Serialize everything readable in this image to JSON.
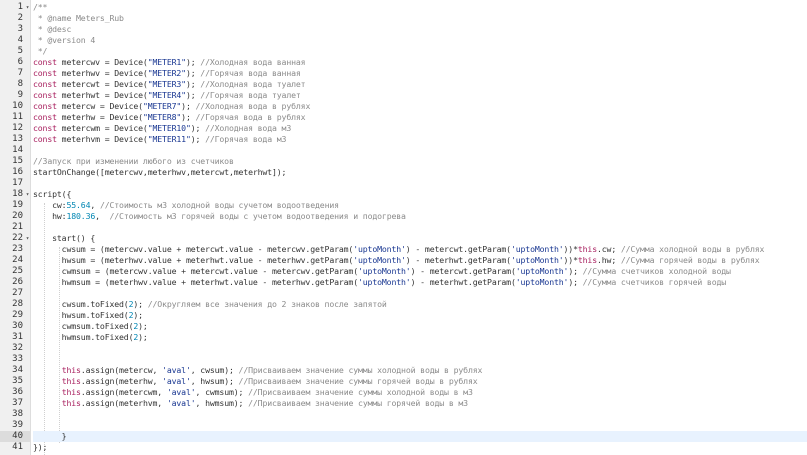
{
  "editor": {
    "lines": [
      [
        [
          "cm",
          "/**"
        ]
      ],
      [
        [
          "cm",
          " * @name Meters_Rub"
        ]
      ],
      [
        [
          "cm",
          " * @desc"
        ]
      ],
      [
        [
          "cm",
          " * @version 4"
        ]
      ],
      [
        [
          "cm",
          " */"
        ]
      ],
      [
        [
          "kw",
          "const"
        ],
        [
          "t",
          " metercwv = Device("
        ],
        [
          "str",
          "\"METER1\""
        ],
        [
          "t",
          "); "
        ],
        [
          "cm",
          "//Холодная вода ванная"
        ]
      ],
      [
        [
          "kw",
          "const"
        ],
        [
          "t",
          " meterhwv = Device("
        ],
        [
          "str",
          "\"METER2\""
        ],
        [
          "t",
          "); "
        ],
        [
          "cm",
          "//Горячая вода ванная"
        ]
      ],
      [
        [
          "kw",
          "const"
        ],
        [
          "t",
          " metercwt = Device("
        ],
        [
          "str",
          "\"METER3\""
        ],
        [
          "t",
          "); "
        ],
        [
          "cm",
          "//Холодная вода туалет"
        ]
      ],
      [
        [
          "kw",
          "const"
        ],
        [
          "t",
          " meterhwt = Device("
        ],
        [
          "str",
          "\"METER4\""
        ],
        [
          "t",
          "); "
        ],
        [
          "cm",
          "//Горячая вода туалет"
        ]
      ],
      [
        [
          "kw",
          "const"
        ],
        [
          "t",
          " metercw = Device("
        ],
        [
          "str",
          "\"METER7\""
        ],
        [
          "t",
          "); "
        ],
        [
          "cm",
          "//Холодная вода в рублях"
        ]
      ],
      [
        [
          "kw",
          "const"
        ],
        [
          "t",
          " meterhw = Device("
        ],
        [
          "str",
          "\"METER8\""
        ],
        [
          "t",
          "); "
        ],
        [
          "cm",
          "//Горячая вода в рублях"
        ]
      ],
      [
        [
          "kw",
          "const"
        ],
        [
          "t",
          " metercwm = Device("
        ],
        [
          "str",
          "\"METER10\""
        ],
        [
          "t",
          "); "
        ],
        [
          "cm",
          "//Холодная вода м3"
        ]
      ],
      [
        [
          "kw",
          "const"
        ],
        [
          "t",
          " meterhvm = Device("
        ],
        [
          "str",
          "\"METER11\""
        ],
        [
          "t",
          "); "
        ],
        [
          "cm",
          "//Горячая вода м3"
        ]
      ],
      [],
      [
        [
          "cm",
          "//Запуск при изменении любого из счетчиков"
        ]
      ],
      [
        [
          "t",
          "startOnChange([metercwv,meterhwv,metercwt,meterhwt]);"
        ]
      ],
      [],
      [
        [
          "t",
          "script({"
        ]
      ],
      [
        [
          "t",
          "    cw:"
        ],
        [
          "num",
          "55.64"
        ],
        [
          "t",
          ", "
        ],
        [
          "cm",
          "//Стоимость м3 холодной воды сучетом водоотведения"
        ]
      ],
      [
        [
          "t",
          "    hw:"
        ],
        [
          "num",
          "180.36"
        ],
        [
          "t",
          ",  "
        ],
        [
          "cm",
          "//Стоимость м3 горячей воды с учетом водоотведения и подогрева"
        ]
      ],
      [],
      [
        [
          "t",
          "    start() {"
        ]
      ],
      [
        [
          "t",
          "      cwsum = (metercwv.value + metercwt.value - metercwv.getParam("
        ],
        [
          "str",
          "'uptoMonth'"
        ],
        [
          "t",
          ") - metercwt.getParam("
        ],
        [
          "str",
          "'uptoMonth'"
        ],
        [
          "t",
          "))*"
        ],
        [
          "kw",
          "this"
        ],
        [
          "t",
          ".cw; "
        ],
        [
          "cm",
          "//Сумма холодной воды в рублях"
        ]
      ],
      [
        [
          "t",
          "      hwsum = (meterhwv.value + meterhwt.value - meterhwv.getParam("
        ],
        [
          "str",
          "'uptoMonth'"
        ],
        [
          "t",
          ") - meterhwt.getParam("
        ],
        [
          "str",
          "'uptoMonth'"
        ],
        [
          "t",
          "))*"
        ],
        [
          "kw",
          "this"
        ],
        [
          "t",
          ".hw; "
        ],
        [
          "cm",
          "//Сумма горячей воды в рублях"
        ]
      ],
      [
        [
          "t",
          "      cwmsum = (metercwv.value + metercwt.value - metercwv.getParam("
        ],
        [
          "str",
          "'uptoMonth'"
        ],
        [
          "t",
          ") - metercwt.getParam("
        ],
        [
          "str",
          "'uptoMonth'"
        ],
        [
          "t",
          "); "
        ],
        [
          "cm",
          "//Сумма счетчиков холодной воды"
        ]
      ],
      [
        [
          "t",
          "      hwmsum = (meterhwv.value + meterhwt.value - meterhwv.getParam("
        ],
        [
          "str",
          "'uptoMonth'"
        ],
        [
          "t",
          ") - meterhwt.getParam("
        ],
        [
          "str",
          "'uptoMonth'"
        ],
        [
          "t",
          "); "
        ],
        [
          "cm",
          "//Сумма счетчиков горячей воды"
        ]
      ],
      [],
      [
        [
          "t",
          "      cwsum.toFixed("
        ],
        [
          "num",
          "2"
        ],
        [
          "t",
          "); "
        ],
        [
          "cm",
          "//Округляем все значения до 2 знаков после запятой"
        ]
      ],
      [
        [
          "t",
          "      hwsum.toFixed("
        ],
        [
          "num",
          "2"
        ],
        [
          "t",
          ");"
        ]
      ],
      [
        [
          "t",
          "      cwmsum.toFixed("
        ],
        [
          "num",
          "2"
        ],
        [
          "t",
          ");"
        ]
      ],
      [
        [
          "t",
          "      hwmsum.toFixed("
        ],
        [
          "num",
          "2"
        ],
        [
          "t",
          ");"
        ]
      ],
      [],
      [],
      [
        [
          "t",
          "      "
        ],
        [
          "kw",
          "this"
        ],
        [
          "t",
          ".assign(metercw, "
        ],
        [
          "str",
          "'aval'"
        ],
        [
          "t",
          ", cwsum); "
        ],
        [
          "cm",
          "//Присваиваем значение суммы холодной воды в рублях"
        ]
      ],
      [
        [
          "t",
          "      "
        ],
        [
          "kw",
          "this"
        ],
        [
          "t",
          ".assign(meterhw, "
        ],
        [
          "str",
          "'aval'"
        ],
        [
          "t",
          ", hwsum); "
        ],
        [
          "cm",
          "//Присваиваем значение суммы горячей воды в рублях"
        ]
      ],
      [
        [
          "t",
          "      "
        ],
        [
          "kw",
          "this"
        ],
        [
          "t",
          ".assign(metercwm, "
        ],
        [
          "str",
          "'aval'"
        ],
        [
          "t",
          ", cwmsum); "
        ],
        [
          "cm",
          "//Присваиваем значение суммы холодной воды в м3"
        ]
      ],
      [
        [
          "t",
          "      "
        ],
        [
          "kw",
          "this"
        ],
        [
          "t",
          ".assign(meterhvm, "
        ],
        [
          "str",
          "'aval'"
        ],
        [
          "t",
          ", hwmsum); "
        ],
        [
          "cm",
          "//Присваиваем значение суммы горячей воды в м3"
        ]
      ],
      [],
      [],
      [
        [
          "t",
          "      }"
        ]
      ],
      [
        [
          "t",
          "});"
        ]
      ]
    ],
    "fold_lines": [
      1,
      18,
      22
    ],
    "fold_glyph": "▾",
    "active_line": 40
  }
}
